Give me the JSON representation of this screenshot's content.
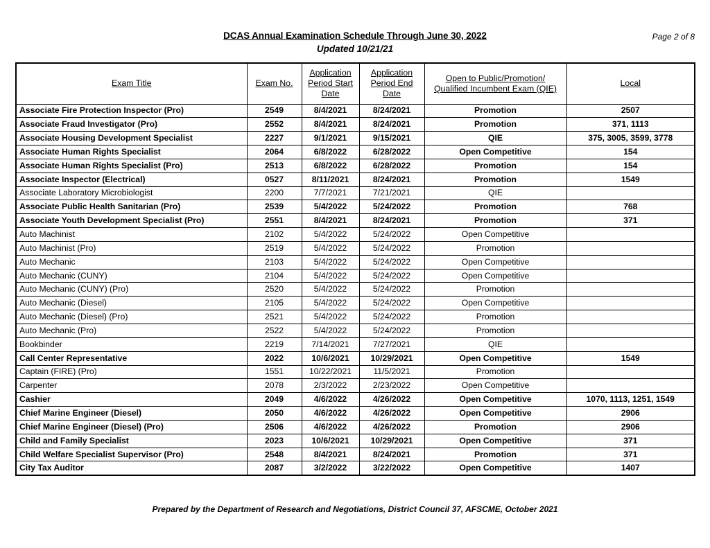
{
  "header": {
    "title": "DCAS Annual Examination Schedule Through June 30, 2022",
    "subtitle": "Updated 10/21/21",
    "page_number": "Page 2 of 8"
  },
  "table": {
    "columns": [
      {
        "key": "title",
        "label": "Exam Title",
        "lines": [
          "Exam Title"
        ]
      },
      {
        "key": "no",
        "label": "Exam No.",
        "lines": [
          "Exam No."
        ]
      },
      {
        "key": "start",
        "label": "Application Period Start Date",
        "lines": [
          "Application",
          "Period Start",
          "Date"
        ]
      },
      {
        "key": "end",
        "label": "Application Period End Date",
        "lines": [
          "Application",
          "Period End",
          "Date"
        ]
      },
      {
        "key": "qie",
        "label": "Open to Public/Promotion/ Qualified Incumbent Exam (QIE)",
        "lines": [
          "Open to Public/Promotion/",
          "Qualified Incumbent Exam (QIE)"
        ]
      },
      {
        "key": "local",
        "label": "Local",
        "lines": [
          "Local"
        ]
      }
    ],
    "rows": [
      {
        "bold": true,
        "title": "Associate Fire Protection Inspector (Pro)",
        "no": "2549",
        "start": "8/4/2021",
        "end": "8/24/2021",
        "qie": "Promotion",
        "local": "2507"
      },
      {
        "bold": true,
        "title": "Associate Fraud Investigator (Pro)",
        "no": "2552",
        "start": "8/4/2021",
        "end": "8/24/2021",
        "qie": "Promotion",
        "local": "371, 1113"
      },
      {
        "bold": true,
        "title": "Associate Housing Development Specialist",
        "no": "2227",
        "start": "9/1/2021",
        "end": "9/15/2021",
        "qie": "QIE",
        "local": "375, 3005, 3599, 3778"
      },
      {
        "bold": true,
        "title": "Associate Human Rights Specialist",
        "no": "2064",
        "start": "6/8/2022",
        "end": "6/28/2022",
        "qie": "Open Competitive",
        "local": "154"
      },
      {
        "bold": true,
        "title": "Associate Human Rights Specialist (Pro)",
        "no": "2513",
        "start": "6/8/2022",
        "end": "6/28/2022",
        "qie": "Promotion",
        "local": "154"
      },
      {
        "bold": true,
        "title": "Associate Inspector (Electrical)",
        "no": "0527",
        "start": "8/11/2021",
        "end": "8/24/2021",
        "qie": "Promotion",
        "local": "1549"
      },
      {
        "bold": false,
        "title": "Associate Laboratory Microbiologist",
        "no": "2200",
        "start": "7/7/2021",
        "end": "7/21/2021",
        "qie": "QIE",
        "local": ""
      },
      {
        "bold": true,
        "title": "Associate Public Health Sanitarian (Pro)",
        "no": "2539",
        "start": "5/4/2022",
        "end": "5/24/2022",
        "qie": "Promotion",
        "local": "768"
      },
      {
        "bold": true,
        "title": "Associate Youth Development Specialist (Pro)",
        "no": "2551",
        "start": "8/4/2021",
        "end": "8/24/2021",
        "qie": "Promotion",
        "local": "371"
      },
      {
        "bold": false,
        "title": "Auto Machinist",
        "no": "2102",
        "start": "5/4/2022",
        "end": "5/24/2022",
        "qie": "Open Competitive",
        "local": ""
      },
      {
        "bold": false,
        "title": "Auto Machinist (Pro)",
        "no": "2519",
        "start": "5/4/2022",
        "end": "5/24/2022",
        "qie": "Promotion",
        "local": ""
      },
      {
        "bold": false,
        "title": "Auto Mechanic",
        "no": "2103",
        "start": "5/4/2022",
        "end": "5/24/2022",
        "qie": "Open Competitive",
        "local": ""
      },
      {
        "bold": false,
        "title": "Auto Mechanic (CUNY)",
        "no": "2104",
        "start": "5/4/2022",
        "end": "5/24/2022",
        "qie": "Open Competitive",
        "local": ""
      },
      {
        "bold": false,
        "title": "Auto Mechanic (CUNY) (Pro)",
        "no": "2520",
        "start": "5/4/2022",
        "end": "5/24/2022",
        "qie": "Promotion",
        "local": ""
      },
      {
        "bold": false,
        "title": "Auto Mechanic (Diesel)",
        "no": "2105",
        "start": "5/4/2022",
        "end": "5/24/2022",
        "qie": "Open Competitive",
        "local": ""
      },
      {
        "bold": false,
        "title": "Auto Mechanic (Diesel) (Pro)",
        "no": "2521",
        "start": "5/4/2022",
        "end": "5/24/2022",
        "qie": "Promotion",
        "local": ""
      },
      {
        "bold": false,
        "title": "Auto Mechanic (Pro)",
        "no": "2522",
        "start": "5/4/2022",
        "end": "5/24/2022",
        "qie": "Promotion",
        "local": ""
      },
      {
        "bold": false,
        "title": "Bookbinder",
        "no": "2219",
        "start": "7/14/2021",
        "end": "7/27/2021",
        "qie": "QIE",
        "local": ""
      },
      {
        "bold": true,
        "title": "Call Center Representative",
        "no": "2022",
        "start": "10/6/2021",
        "end": "10/29/2021",
        "qie": "Open Competitive",
        "local": "1549"
      },
      {
        "bold": false,
        "title": "Captain (FIRE) (Pro)",
        "no": "1551",
        "start": "10/22/2021",
        "end": "11/5/2021",
        "qie": "Promotion",
        "local": ""
      },
      {
        "bold": false,
        "title": "Carpenter",
        "no": "2078",
        "start": "2/3/2022",
        "end": "2/23/2022",
        "qie": "Open Competitive",
        "local": ""
      },
      {
        "bold": true,
        "title": "Cashier",
        "no": "2049",
        "start": "4/6/2022",
        "end": "4/26/2022",
        "qie": "Open Competitive",
        "local": "1070, 1113, 1251, 1549"
      },
      {
        "bold": true,
        "title": "Chief Marine Engineer (Diesel)",
        "no": "2050",
        "start": "4/6/2022",
        "end": "4/26/2022",
        "qie": "Open Competitive",
        "local": "2906"
      },
      {
        "bold": true,
        "title": "Chief Marine Engineer (Diesel) (Pro)",
        "no": "2506",
        "start": "4/6/2022",
        "end": "4/26/2022",
        "qie": "Promotion",
        "local": "2906"
      },
      {
        "bold": true,
        "title": "Child and Family Specialist",
        "no": "2023",
        "start": "10/6/2021",
        "end": "10/29/2021",
        "qie": "Open Competitive",
        "local": "371"
      },
      {
        "bold": true,
        "title": "Child Welfare Specialist Supervisor (Pro)",
        "no": "2548",
        "start": "8/4/2021",
        "end": "8/24/2021",
        "qie": "Promotion",
        "local": "371"
      },
      {
        "bold": true,
        "title": "City Tax Auditor",
        "no": "2087",
        "start": "3/2/2022",
        "end": "3/22/2022",
        "qie": "Open Competitive",
        "local": "1407"
      }
    ]
  },
  "footer": {
    "text": "Prepared by the Department of Research and Negotiations, District Council 37, AFSCME, October 2021"
  }
}
